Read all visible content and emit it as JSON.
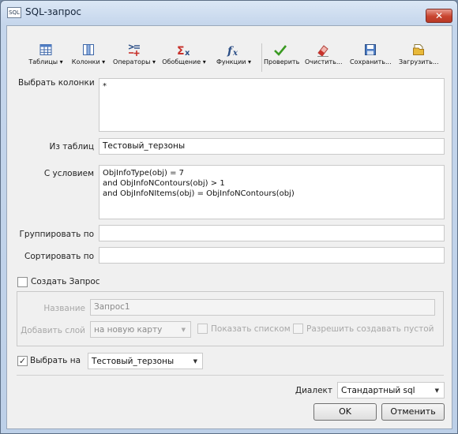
{
  "window": {
    "title": "SQL-запрос",
    "icon_text": "SQL",
    "close_glyph": "✕"
  },
  "toolbar": {
    "tables": "Таблицы ▾",
    "columns": "Колонки ▾",
    "operators": "Операторы ▾",
    "aggregate": "Обобщение ▾",
    "functions": "Функции ▾",
    "check": "Проверить",
    "clear": "Очистить...",
    "save": "Сохранить...",
    "load": "Загрузить..."
  },
  "form": {
    "select_columns_label": "Выбрать колонки",
    "select_columns_value": "*",
    "from_tables_label": "Из таблиц",
    "from_tables_value": "Тестовый_терзоны",
    "where_label": "С условием",
    "where_value": "ObjInfoType(obj) = 7\nand ObjInfoNContours(obj) > 1\nand ObjInfoNItems(obj) = ObjInfoNContours(obj)",
    "group_by_label": "Группировать по",
    "group_by_value": "",
    "order_by_label": "Сортировать по",
    "order_by_value": ""
  },
  "create_query": {
    "checkbox_label": "Создать Запрос",
    "checked": false,
    "name_label": "Название",
    "name_value": "Запрос1",
    "add_layer_label": "Добавить слой",
    "add_layer_value": "на новую карту",
    "show_list_label": "Показать списком",
    "allow_empty_label": "Разрешить создавать пустой"
  },
  "select_on": {
    "label": "Выбрать на",
    "checked": true,
    "check_glyph": "✓",
    "value": "Тестовый_терзоны"
  },
  "dialect": {
    "label": "Диалект",
    "value": "Стандартный sql"
  },
  "buttons": {
    "ok": "OK",
    "cancel": "Отменить"
  },
  "glyphs": {
    "dropdown_arrow": "▼"
  }
}
